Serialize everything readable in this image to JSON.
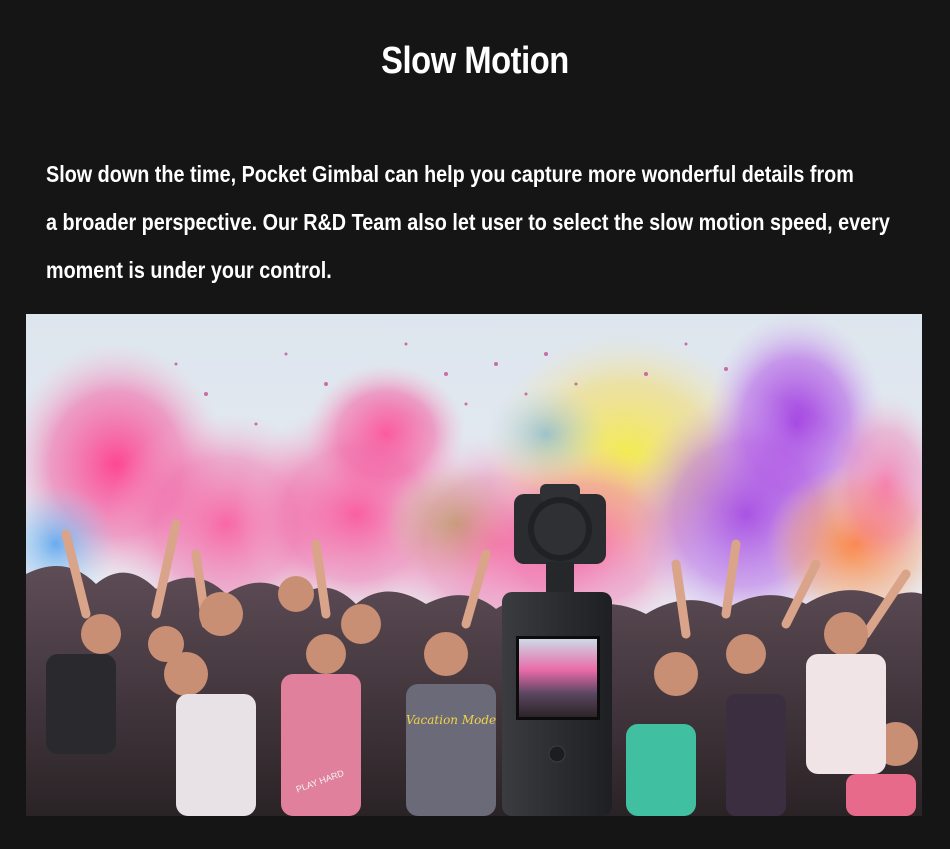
{
  "title": "Slow Motion",
  "description": {
    "line1": "Slow down the time, Pocket Gimbal  can help you capture more wonderful details from",
    "line2": "a broader perspective. Our R&D Team also let user to select the slow motion speed, every",
    "line3": "moment is under your control."
  },
  "photo": {
    "subject": "holi-color-festival-crowd",
    "device": "pocket-gimbal-camera",
    "shirt_text": "Vacation Mode",
    "shirt_text_2": "PLAY HARD"
  },
  "colors": {
    "background": "#151515",
    "text": "#ffffff",
    "powder_pink": "#f0448f",
    "powder_purple": "#a33ad8",
    "powder_yellow": "#f2e24a",
    "powder_orange": "#f5833a",
    "device_body": "#2e3034"
  }
}
